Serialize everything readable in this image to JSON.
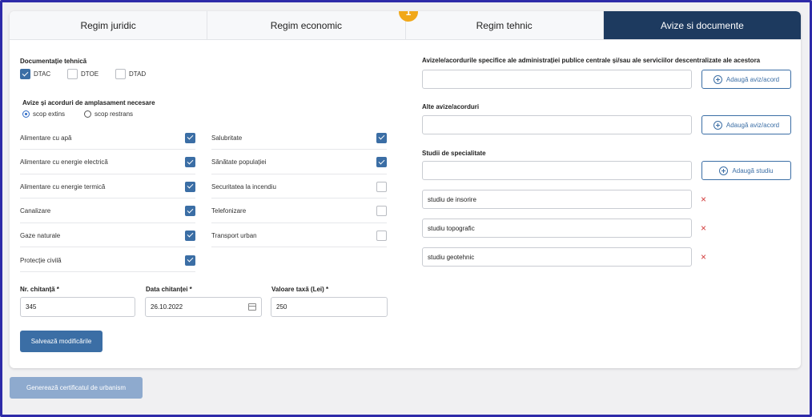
{
  "tabs": [
    {
      "label": "Regim juridic"
    },
    {
      "label": "Regim economic"
    },
    {
      "label": "Regim tehnic"
    },
    {
      "label": "Avize si documente"
    }
  ],
  "step_badge": "1",
  "doc_tehnica": {
    "title": "Documentație tehnică",
    "options": [
      {
        "label": "DTAC",
        "checked": true
      },
      {
        "label": "DTOE",
        "checked": false
      },
      {
        "label": "DTAD",
        "checked": false
      }
    ]
  },
  "avize": {
    "title": "Avize și acorduri de amplasament necesare",
    "radio": [
      {
        "label": "scop extins",
        "selected": true
      },
      {
        "label": "scop restrans",
        "selected": false
      }
    ],
    "left": [
      {
        "label": "Alimentare cu apă",
        "checked": true
      },
      {
        "label": "Alimentare cu energie electrică",
        "checked": true
      },
      {
        "label": "Alimentare cu energie termică",
        "checked": true
      },
      {
        "label": "Canalizare",
        "checked": true
      },
      {
        "label": "Gaze naturale",
        "checked": true
      },
      {
        "label": "Protecție civilă",
        "checked": true
      }
    ],
    "right": [
      {
        "label": "Salubritate",
        "checked": true
      },
      {
        "label": "Sănătate populației",
        "checked": true
      },
      {
        "label": "Securitatea la incendiu",
        "checked": false
      },
      {
        "label": "Telefonizare",
        "checked": false
      },
      {
        "label": "Transport urban",
        "checked": false
      }
    ]
  },
  "receipt": {
    "nr_label": "Nr. chitanță *",
    "nr_value": "345",
    "date_label": "Data chitanței *",
    "date_value": "26.10.2022",
    "tax_label": "Valoare taxă (Lei) *",
    "tax_value": "250"
  },
  "save_button": "Salvează modificările",
  "generate_button": "Generează certificatul de urbanism",
  "right_panel": {
    "avize_label": "Avizele/acordurile specifice ale administrației publice centrale și/sau ale serviciilor descentralizate ale acestora",
    "add_aviz": "Adaugă aviz/acord",
    "alte_label": "Alte avize/acorduri",
    "add_aviz2": "Adaugă aviz/acord",
    "studii_label": "Studii de specialitate",
    "add_studiu": "Adaugă studiu",
    "studii": [
      "studiu de insorire",
      "studiu topografic",
      "studiu geotehnic"
    ],
    "remove_icon": "×"
  },
  "colors": {
    "accent": "#3b6ea5",
    "active_tab": "#1d3a5f",
    "badge": "#f1a81a",
    "frame": "#2d2aa8",
    "remove": "#d23b3b"
  }
}
